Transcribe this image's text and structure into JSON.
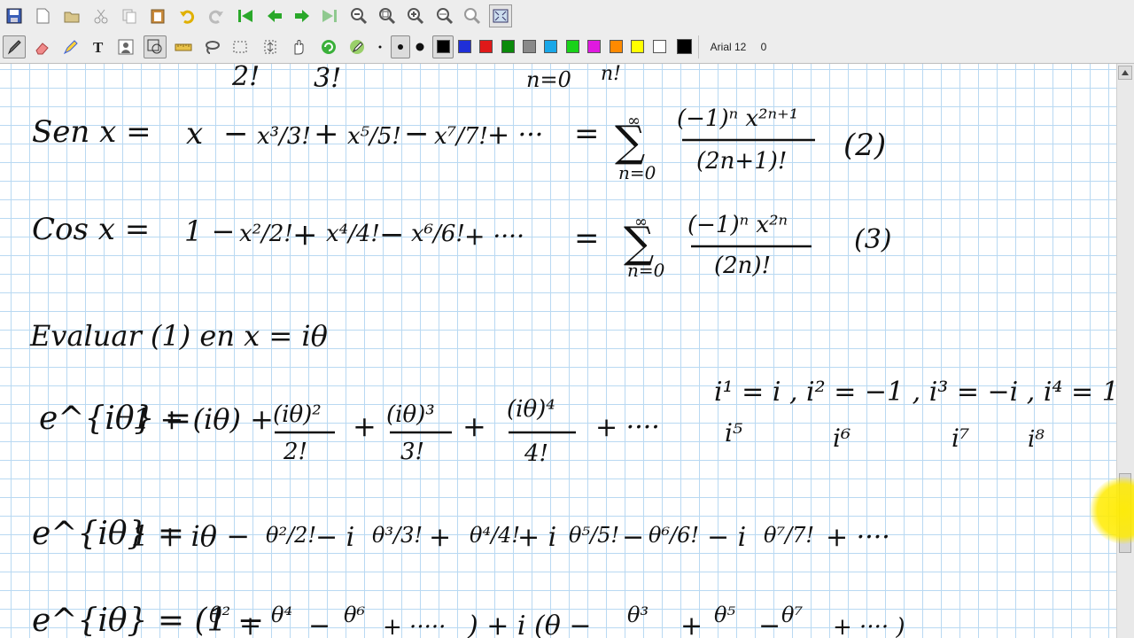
{
  "toolbar_top": {
    "buttons": [
      "save-icon",
      "new-page-icon",
      "open-folder-icon",
      "cut-icon",
      "copy-icon",
      "paste-icon",
      "undo-icon",
      "redo-icon",
      "first-page-icon",
      "previous-page-icon",
      "next-page-icon",
      "last-page-icon",
      "zoom-out-icon",
      "zoom-fit-icon",
      "zoom-in-icon",
      "zoom-width-icon",
      "zoom-icon",
      "fullscreen-icon"
    ]
  },
  "toolbar_tools": {
    "font_name": "Arial 12",
    "font_size": "0",
    "colors": [
      "#000000",
      "#1f2fd8",
      "#e01919",
      "#0b8a0b",
      "#8a8a8a",
      "#19a7e8",
      "#19d219",
      "#e019e0",
      "#ff8a00",
      "#ffff00",
      "#ffffff",
      "#000000"
    ]
  },
  "handwriting": {
    "top_fragment": [
      "2!",
      "3!",
      "n=0",
      "n!"
    ],
    "line_sen": {
      "lhs": "Sen x =",
      "terms": [
        "x",
        "−",
        "x³/3!",
        "+",
        "x⁵/5!",
        "−",
        "x⁷/7!",
        "+ ···",
        "="
      ],
      "sum_top": "∞",
      "sum_bottom": "n=0",
      "frac_num": "(−1)ⁿ x²ⁿ⁺¹",
      "frac_den": "(2n+1)!",
      "tag": "(2)"
    },
    "line_cos": {
      "lhs": "Cos x =",
      "terms": [
        "1 −",
        "x²/2!",
        "+",
        "x⁴/4!",
        "−",
        "x⁶/6!",
        "+ ····",
        "="
      ],
      "sum_top": "∞",
      "sum_bottom": "n=0",
      "frac_num": "(−1)ⁿ x²ⁿ",
      "frac_den": "(2n)!",
      "tag": "(3)"
    },
    "line_eval": "Evaluar (1) en  x = iθ",
    "line_e1": {
      "lhs": "e^{iθ} =",
      "body": "1 + (iθ) +",
      "f1_num": "(iθ)²",
      "f1_den": "2!",
      "f2_num": "(iθ)³",
      "f2_den": "3!",
      "f3_num": "(iθ)⁴",
      "f3_den": "4!",
      "tail": "+ ····",
      "powers_row1": "i¹ = i ,  i² = −1 ,  i³ = −i ,  i⁴ = 1",
      "powers_row2": [
        "i⁵",
        "i⁶",
        "i⁷",
        "i⁸"
      ]
    },
    "line_e2": {
      "lhs": "e^{iθ} =",
      "body": "1 + iθ −",
      "terms": [
        "θ²/2!",
        "− i",
        "θ³/3!",
        "+",
        "θ⁴/4!",
        "+ i",
        "θ⁵/5!",
        "−",
        "θ⁶/6!",
        "− i",
        "θ⁷/7!",
        "+ ····"
      ]
    },
    "line_e3": {
      "lhs": "e^{iθ} = (1 −",
      "terms": [
        "θ²",
        "+",
        "θ⁴",
        "−",
        "θ⁶",
        "+ ·····",
        ") + i (θ −",
        "θ³",
        "+",
        "θ⁵",
        "−",
        "θ⁷",
        "+ ···· )"
      ]
    }
  }
}
